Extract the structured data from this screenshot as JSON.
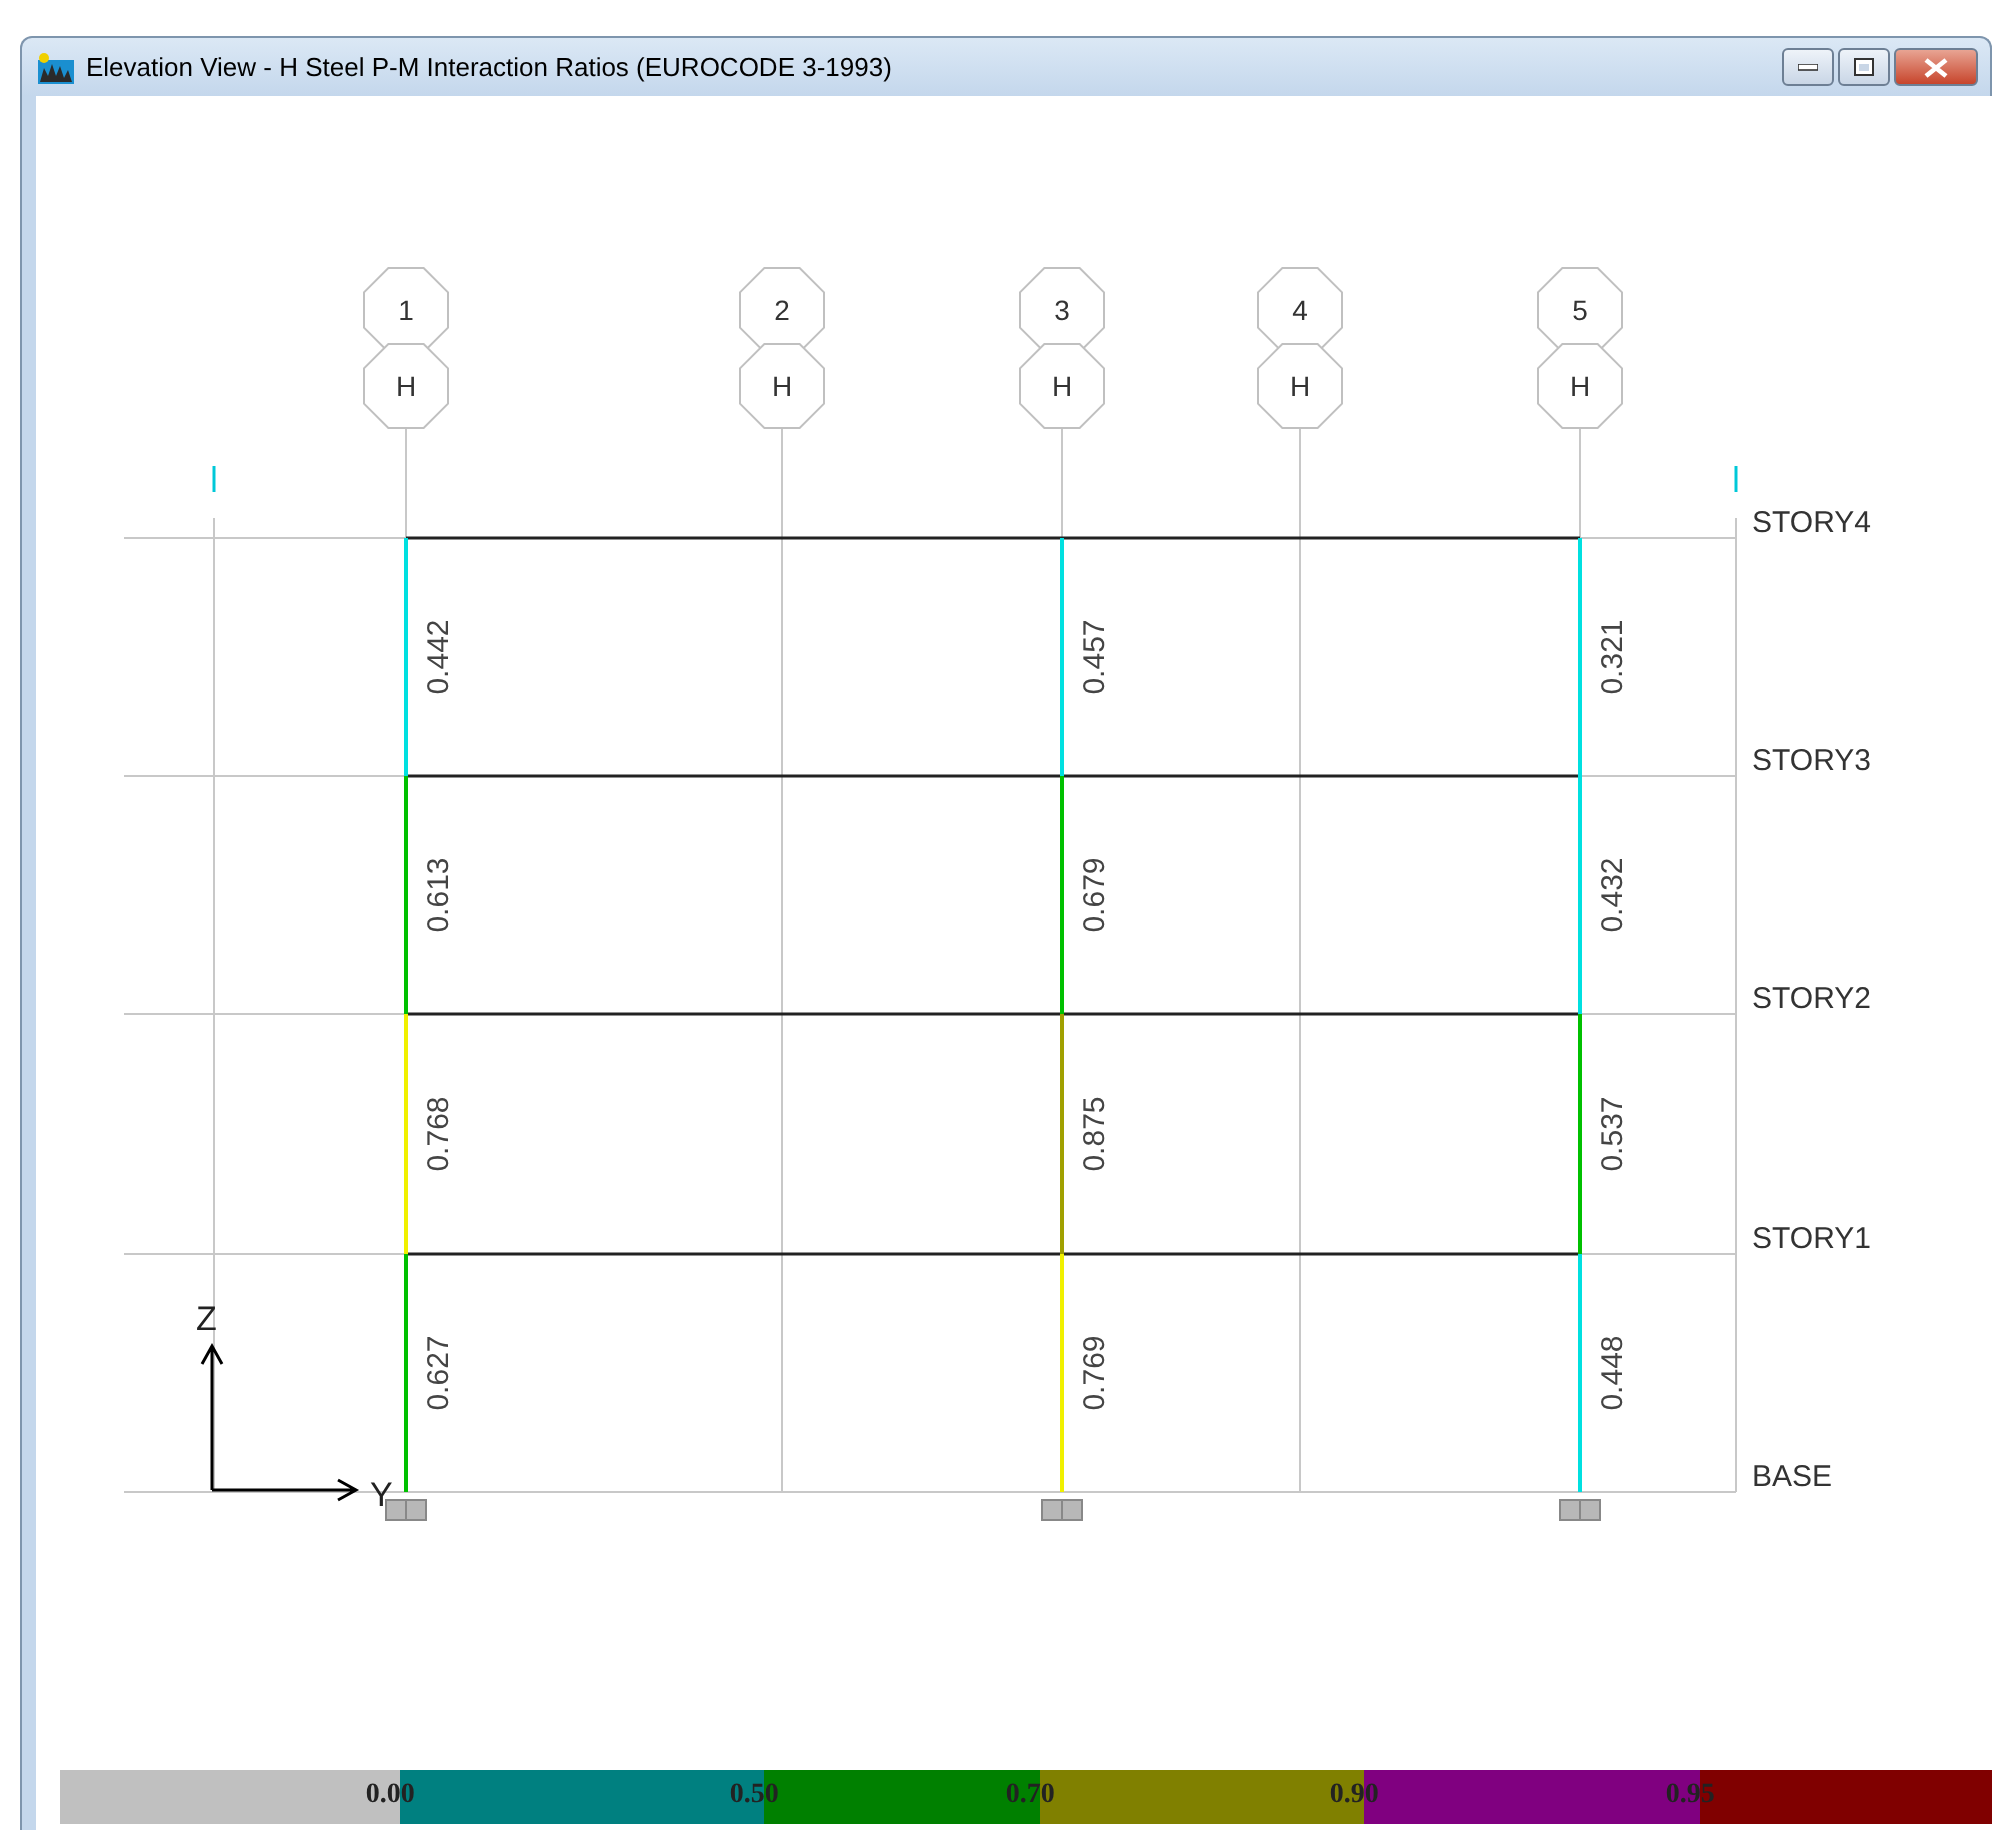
{
  "window": {
    "title": "Elevation View - H  Steel P-M Interaction Ratios  (EUROCODE 3-1993)"
  },
  "grid_bubbles": [
    {
      "number": "1",
      "axis": "H"
    },
    {
      "number": "2",
      "axis": "H"
    },
    {
      "number": "3",
      "axis": "H"
    },
    {
      "number": "4",
      "axis": "H"
    },
    {
      "number": "5",
      "axis": "H"
    }
  ],
  "stories": [
    {
      "name": "STORY4"
    },
    {
      "name": "STORY3"
    },
    {
      "name": "STORY2"
    },
    {
      "name": "STORY1"
    },
    {
      "name": "BASE"
    }
  ],
  "columns": [
    {
      "segments": [
        {
          "ratio": "0.442",
          "color": "#00e0e0"
        },
        {
          "ratio": "0.613",
          "color": "#00c000"
        },
        {
          "ratio": "0.768",
          "color": "#f0f000"
        },
        {
          "ratio": "0.627",
          "color": "#00c000"
        }
      ]
    },
    {
      "segments": [
        {
          "ratio": "0.457",
          "color": "#00e0e0"
        },
        {
          "ratio": "0.679",
          "color": "#00c000"
        },
        {
          "ratio": "0.875",
          "color": "#a0a000"
        },
        {
          "ratio": "0.769",
          "color": "#f0f000"
        }
      ]
    },
    {
      "segments": [
        {
          "ratio": "0.321",
          "color": "#00e0e0"
        },
        {
          "ratio": "0.432",
          "color": "#00e0e0"
        },
        {
          "ratio": "0.537",
          "color": "#00c000"
        },
        {
          "ratio": "0.448",
          "color": "#00e0e0"
        }
      ]
    }
  ],
  "axes": {
    "vertical": "Z",
    "horizontal": "Y"
  },
  "legend": [
    {
      "color": "#c0c0c0"
    },
    {
      "label": "0.00",
      "color": "#008080"
    },
    {
      "label": "0.50",
      "color": "#008000"
    },
    {
      "label": "0.70",
      "color": "#808000"
    },
    {
      "label": "0.90",
      "color": "#800080"
    },
    {
      "label": "0.95",
      "color": "#800000"
    }
  ]
}
